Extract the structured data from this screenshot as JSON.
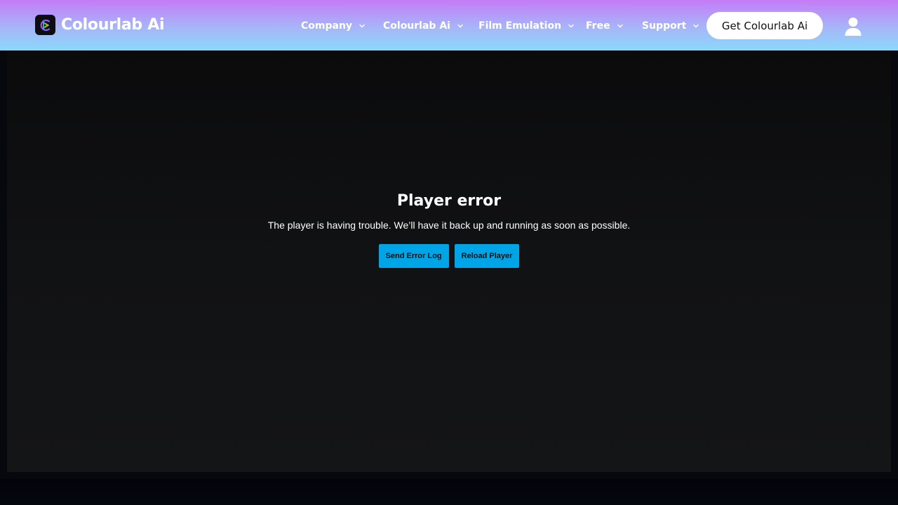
{
  "header": {
    "logo_text": "Colourlab Ai",
    "logo_icon": "colourlab-logo-icon",
    "nav": [
      {
        "label": "Company",
        "icon": "chevron-down-icon"
      },
      {
        "label": "Colourlab Ai",
        "icon": "chevron-down-icon"
      },
      {
        "label": "Film Emulation",
        "icon": "chevron-down-icon"
      },
      {
        "label": "Free",
        "icon": "chevron-down-icon"
      },
      {
        "label": "Support",
        "icon": "chevron-down-icon"
      }
    ],
    "cta_label": "Get Colourlab Ai",
    "account_icon": "user-icon"
  },
  "player": {
    "error_title": "Player error",
    "error_message": "The player is having trouble. We’ll have it back up and running as soon as possible.",
    "send_log_label": "Send Error Log",
    "reload_label": "Reload Player"
  },
  "colors": {
    "header_gradient_top": "#c47cf7",
    "header_gradient_bottom": "#8ad9fb",
    "player_background": "#111214",
    "error_button": "#00a5e8"
  }
}
